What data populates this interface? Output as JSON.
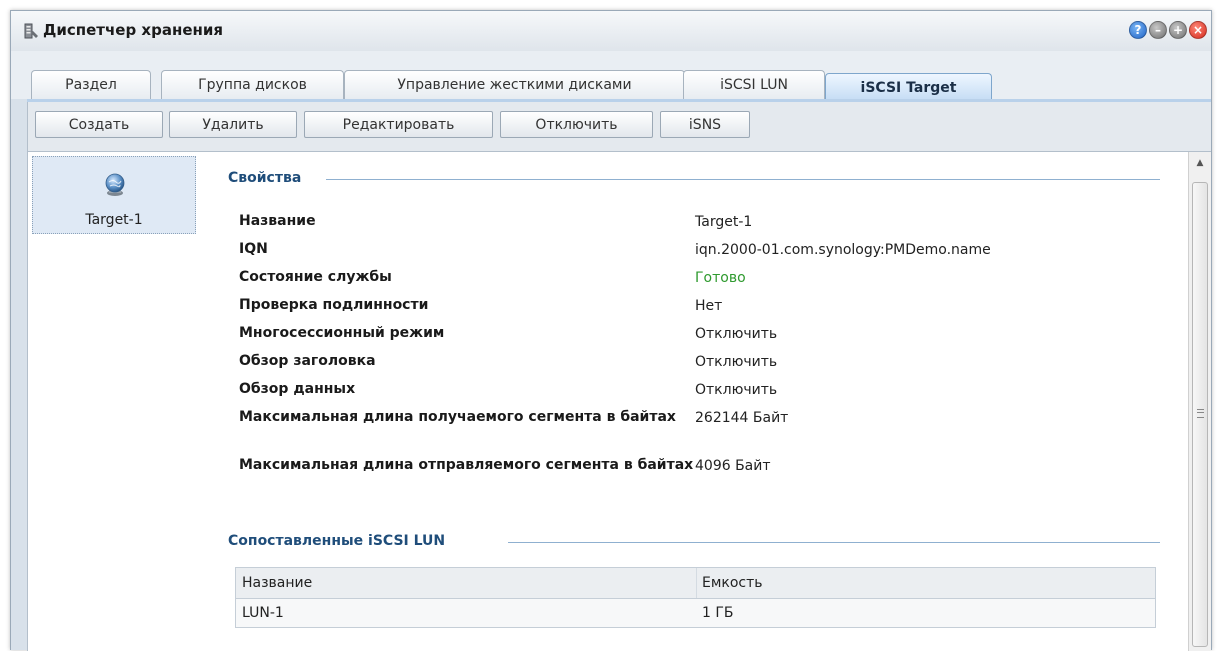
{
  "window": {
    "title": "Диспетчер хранения",
    "controls": [
      "help-icon",
      "minimize-icon",
      "maximize-icon",
      "close-icon"
    ]
  },
  "tabs": [
    {
      "label": "Раздел",
      "active": false
    },
    {
      "label": "Группа дисков",
      "active": false
    },
    {
      "label": "Управление жесткими дисками",
      "active": false
    },
    {
      "label": "iSCSI LUN",
      "active": false
    },
    {
      "label": "iSCSI Target",
      "active": true
    }
  ],
  "toolbar": {
    "create_label": "Создать",
    "delete_label": "Удалить",
    "edit_label": "Редактировать",
    "disable_label": "Отключить",
    "isns_label": "iSNS"
  },
  "targets": [
    {
      "label": "Target-1",
      "icon": "globe-icon",
      "selected": true
    }
  ],
  "properties": {
    "section_title": "Свойства",
    "rows": [
      {
        "label": "Название",
        "value": "Target-1"
      },
      {
        "label": "IQN",
        "value": "iqn.2000-01.com.synology:PMDemo.name"
      },
      {
        "label": "Состояние службы",
        "value": "Готово"
      },
      {
        "label": "Проверка подлинности",
        "value": "Нет"
      },
      {
        "label": "Многосессионный режим",
        "value": "Отключить"
      },
      {
        "label": "Обзор заголовка",
        "value": "Отключить"
      },
      {
        "label": "Обзор данных",
        "value": "Отключить"
      },
      {
        "label": "Максимальная длина получаемого сегмента в байтах",
        "value": "262144 Байт"
      },
      {
        "label": "Максимальная длина отправляемого сегмента в байтах",
        "value": "4096 Байт"
      }
    ]
  },
  "mapped_luns": {
    "section_title": "Сопоставленные iSCSI LUN",
    "columns": [
      "Название",
      "Емкость"
    ],
    "rows": [
      {
        "name": "LUN-1",
        "capacity": "1 ГБ"
      }
    ]
  },
  "colors": {
    "status_ok": "#2f9a2f",
    "section_title": "#1f4d7a",
    "selection": "#dfe9f5"
  }
}
